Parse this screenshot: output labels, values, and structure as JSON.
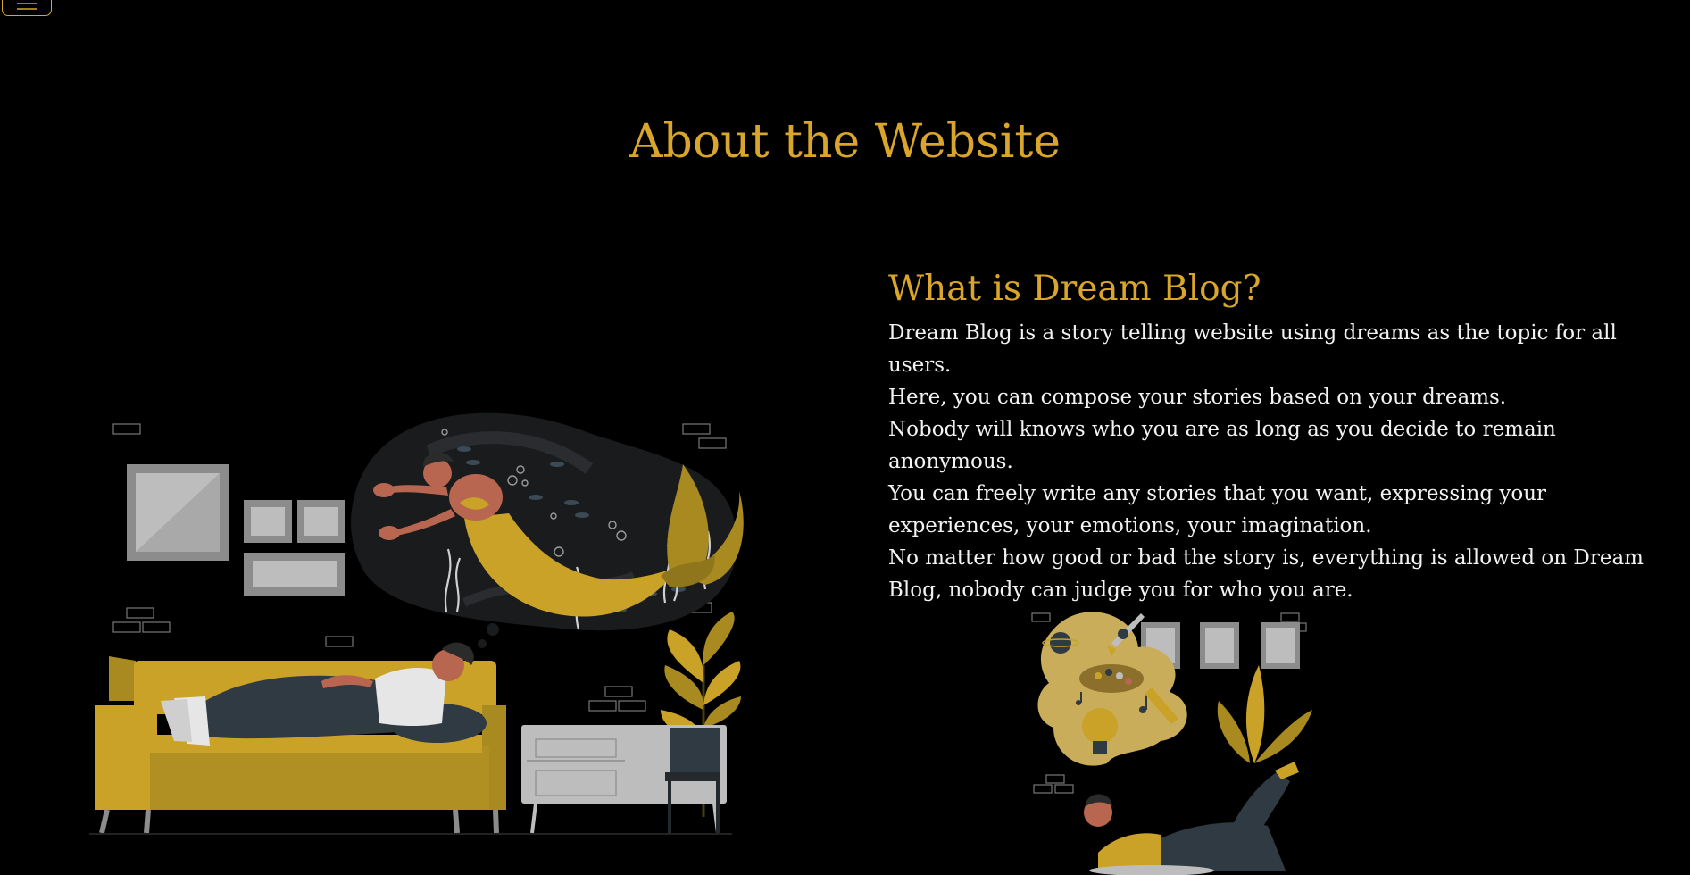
{
  "header": {
    "menu_icon": "hamburger-menu-icon"
  },
  "page": {
    "title": "About the Website"
  },
  "about": {
    "heading": "What is Dream Blog?",
    "paragraphs": [
      "Dream Blog is a story telling website using dreams as the topic for all users.",
      "Here, you can compose your stories based on your dreams.",
      "Nobody will knows who you are as long as you decide to remain anonymous.",
      "You can freely write any stories that you want, expressing your experiences, your emotions, your imagination.",
      "No matter how good or bad the story is, everything is allowed on Dream Blog, nobody can judge you for who you are."
    ]
  },
  "theme": {
    "accent": "#d9a52a",
    "background": "#000000",
    "text": "#f2f2f2"
  }
}
